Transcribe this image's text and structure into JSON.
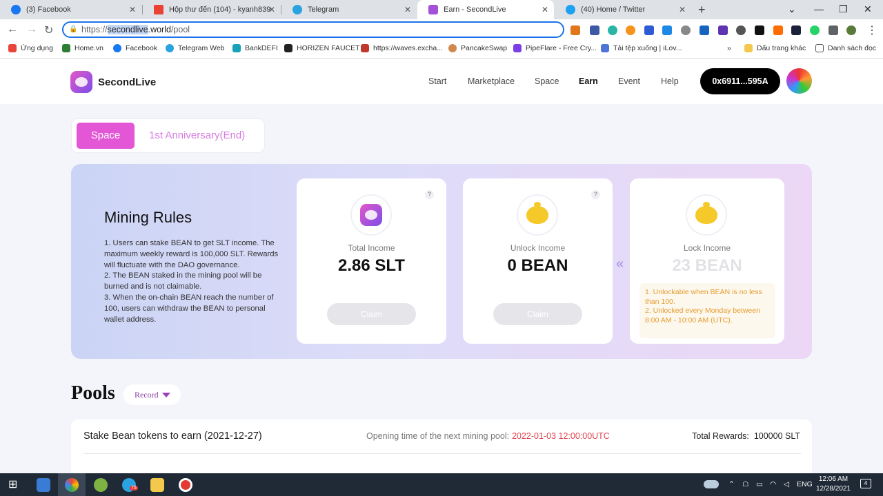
{
  "browser": {
    "tabs": [
      {
        "title": "(3) Facebook",
        "color": "#1877f2"
      },
      {
        "title": "Hộp thư đến (104) - kyanh83900",
        "color": "#ea4335"
      },
      {
        "title": "Telegram",
        "color": "#2aa3e0"
      },
      {
        "title": "Earn - SecondLive",
        "color": "#a450d8"
      },
      {
        "title": "(40) Home / Twitter",
        "color": "#1da1f2"
      }
    ],
    "url_prefix": "https://",
    "url_selected": "secondlive",
    "url_domain_rest": ".world",
    "url_path": "/pool",
    "bookmarks": [
      "Ứng dụng",
      "Home.vn",
      "Facebook",
      "Telegram Web",
      "BankDEFI",
      "HORIZEN FAUCET",
      "https://waves.excha...",
      "PancakeSwap",
      "PipeFlare - Free Cry...",
      "Tải tệp xuống | iLov..."
    ],
    "bookmarks_more": "»",
    "bookmarks_other": "Dấu trang khác",
    "reading_list": "Danh sách đọc"
  },
  "site": {
    "brand": "SecondLive",
    "nav": [
      "Start",
      "Marketplace",
      "Space",
      "Earn",
      "Event",
      "Help"
    ],
    "active_nav": "Earn",
    "wallet": "0x6911...595A",
    "segment": {
      "active": "Space",
      "inactive": "1st Anniversary(End)"
    },
    "rules": {
      "title": "Mining Rules",
      "text": "1. Users can stake BEAN to get SLT income. The maximum weekly reward is 100,000 SLT. Rewards will fluctuate with the DAO governance.\n2. The BEAN staked in the mining pool will be burned and is not claimable.\n3. When the on-chain BEAN reach the number of 100, users can withdraw the BEAN to personal wallet address."
    },
    "cards": [
      {
        "label": "Total Income",
        "value": "2.86 SLT",
        "button": "Claim",
        "help": "?"
      },
      {
        "label": "Unlock Income",
        "value": "0 BEAN",
        "button": "Claim",
        "help": "?"
      },
      {
        "label": "Lock Income",
        "value": "23 BEAN",
        "note": "1. Unlockable when BEAN is no less than 100.\n2. Unlocked every Monday between 8:00 AM - 10:00 AM (UTC)."
      }
    ],
    "arrow": "«",
    "pools": {
      "title": "Pools",
      "record": "Record",
      "row": {
        "name": "Stake Bean tokens to earn (2021-12-27)",
        "opening_label": "Opening time of the next mining pool:",
        "opening_value": "2022-01-03 12:00:00UTC",
        "rewards_label": "Total Rewards:",
        "rewards_value": "100000 SLT"
      }
    }
  },
  "taskbar": {
    "lang": "ENG",
    "time": "12:06 AM",
    "date": "12/28/2021",
    "telegram_badge": "75",
    "notif_count": "4"
  }
}
